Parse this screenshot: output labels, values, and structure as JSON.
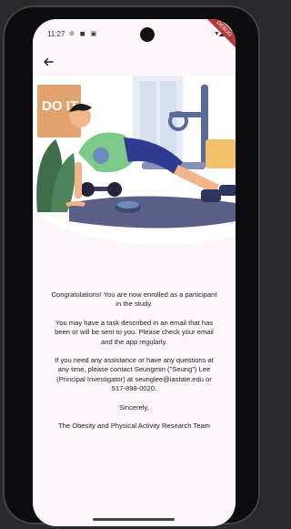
{
  "status": {
    "time": "11:27",
    "left_icons": "⊘ ◼ ▣",
    "right_icons": "▾◢▮"
  },
  "debug_banner": "DEBUG",
  "hero_image": {
    "sign_text": "DO IT",
    "colors": {
      "floor": "#5b5f87",
      "shirt": "#7cc98a",
      "pants": "#2f3b8f",
      "skin": "#f2b48a",
      "sign": "#e2a36f",
      "box": "#f2c16b",
      "plant": "#3f6e4a"
    }
  },
  "message": {
    "congrats": "Congratulations! You are now enrolled as a participant in the study.",
    "task": "You may have a task described in an email that has been or will be sent to you. Please check your email and the app regularly.",
    "assistance": "If you need any assistance or have any questions at any time, please contact Seungmin (\"Seung\") Lee (Principal Investigator) at seunglee@iastate.edu or 517-898-0020.",
    "closing": "Sincerely,",
    "signature": "The Obesity and Physical Activity Research Team"
  }
}
